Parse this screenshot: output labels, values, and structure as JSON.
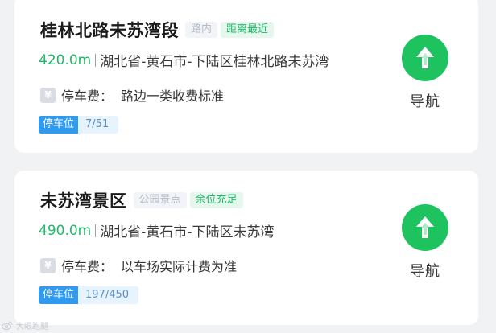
{
  "parking_list": [
    {
      "name": "桂林北路未苏湾段",
      "type_tag": "路内",
      "status_tag": "距离最近",
      "distance": "420.0m",
      "address": "湖北省-黄石市-下陆区桂林北路未苏湾",
      "fee_icon": "¥",
      "fee_label": "停车费：",
      "fee_value": "路边一类收费标准",
      "spaces_label": "停车位",
      "spaces_count": "7/51",
      "nav_label": "导航",
      "nav_icon": "navigation-arrow-icon"
    },
    {
      "name": "未苏湾景区",
      "type_tag": "公园景点",
      "status_tag": "余位充足",
      "distance": "490.0m",
      "address": "湖北省-黄石市-下陆区未苏湾",
      "fee_icon": "¥",
      "fee_label": "停车费：",
      "fee_value": "以车场实际计费为准",
      "spaces_label": "停车位",
      "spaces_count": "197/450",
      "nav_label": "导航",
      "nav_icon": "navigation-arrow-icon"
    }
  ],
  "watermark": {
    "text": "大眼跑腿",
    "icon": "weibo-icon"
  },
  "colors": {
    "accent_green": "#1ec35f",
    "distance_green": "#1eb86a",
    "spaces_blue": "#2f9bf0",
    "background": "#f1f2f4"
  }
}
